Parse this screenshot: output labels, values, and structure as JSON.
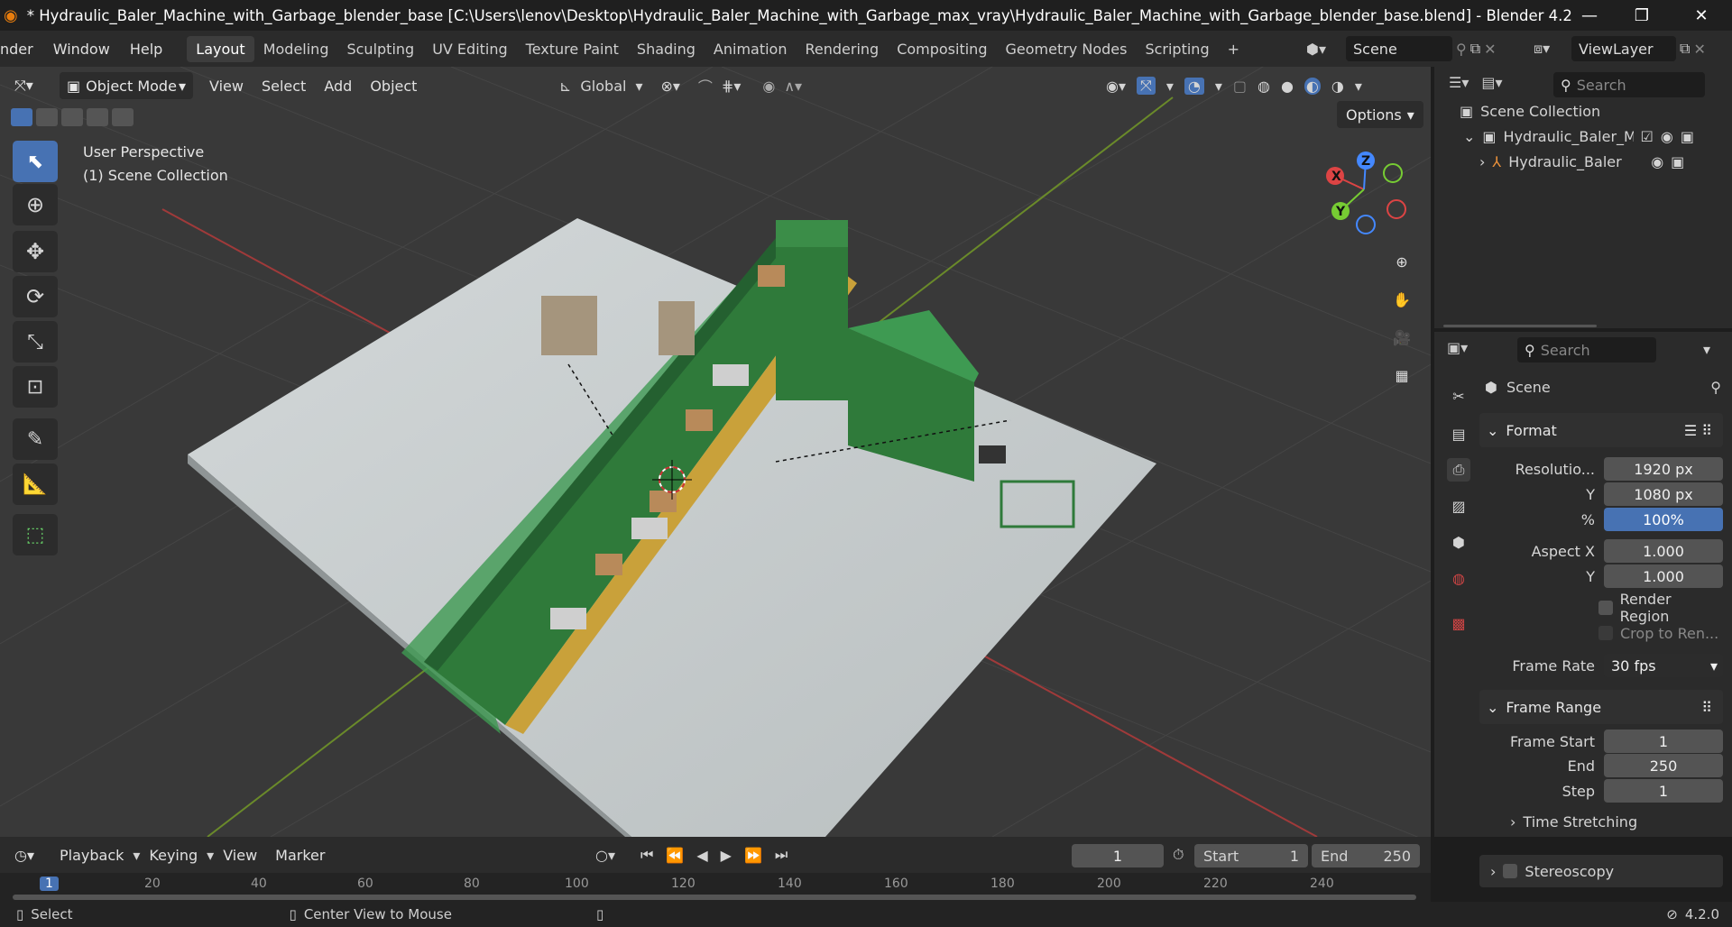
{
  "title_bar": {
    "title": "* Hydraulic_Baler_Machine_with_Garbage_blender_base [C:\\Users\\lenov\\Desktop\\Hydraulic_Baler_Machine_with_Garbage_max_vray\\Hydraulic_Baler_Machine_with_Garbage_blender_base.blend] - Blender 4.2"
  },
  "menu": {
    "items": [
      "nder",
      "Window",
      "Help"
    ]
  },
  "workspaces": [
    "Layout",
    "Modeling",
    "Sculpting",
    "UV Editing",
    "Texture Paint",
    "Shading",
    "Animation",
    "Rendering",
    "Compositing",
    "Geometry Nodes",
    "Scripting"
  ],
  "active_workspace": "Layout",
  "scene_field": "Scene",
  "viewlayer_field": "ViewLayer",
  "viewport": {
    "mode": "Object Mode",
    "menus": [
      "View",
      "Select",
      "Add",
      "Object"
    ],
    "transform_orientation": "Global",
    "options_label": "Options",
    "overlay_line1": "User Perspective",
    "overlay_line2": "(1) Scene Collection",
    "gizmo": {
      "x": "X",
      "y": "Y",
      "z": "Z"
    }
  },
  "outliner": {
    "search_placeholder": "Search",
    "root": "Scene Collection",
    "collection": "Hydraulic_Baler_Ma",
    "object": "Hydraulic_Baler"
  },
  "properties": {
    "search_placeholder": "Search",
    "context": "Scene",
    "format": {
      "title": "Format",
      "resolution_label": "Resolutio...",
      "resolution_x": "1920 px",
      "y_label": "Y",
      "resolution_y": "1080 px",
      "percent_label": "%",
      "percent": "100%",
      "aspect_label": "Aspect X",
      "aspect_x": "1.000",
      "aspect_y_label": "Y",
      "aspect_y": "1.000",
      "render_region": "Render Region",
      "crop": "Crop to Ren...",
      "frame_rate_label": "Frame Rate",
      "frame_rate": "30 fps"
    },
    "frame_range": {
      "title": "Frame Range",
      "start_label": "Frame Start",
      "start": "1",
      "end_label": "End",
      "end": "250",
      "step_label": "Step",
      "step": "1"
    },
    "time_stretching": "Time Stretching",
    "stereoscopy": "Stereoscopy"
  },
  "timeline": {
    "menus": [
      "Playback",
      "Keying",
      "View",
      "Marker"
    ],
    "current_frame": "1",
    "start_label": "Start",
    "start": "1",
    "end_label": "End",
    "end": "250",
    "ruler": [
      "1",
      "20",
      "40",
      "60",
      "80",
      "100",
      "120",
      "140",
      "160",
      "180",
      "200",
      "220",
      "240"
    ]
  },
  "status": {
    "select": "Select",
    "center": "Center View to Mouse",
    "version": "4.2.0"
  },
  "colors": {
    "accent": "#4772b3",
    "machine_green": "#2f7a3a",
    "belt_yellow": "#c9a13a",
    "floor": "#c9cecf"
  }
}
